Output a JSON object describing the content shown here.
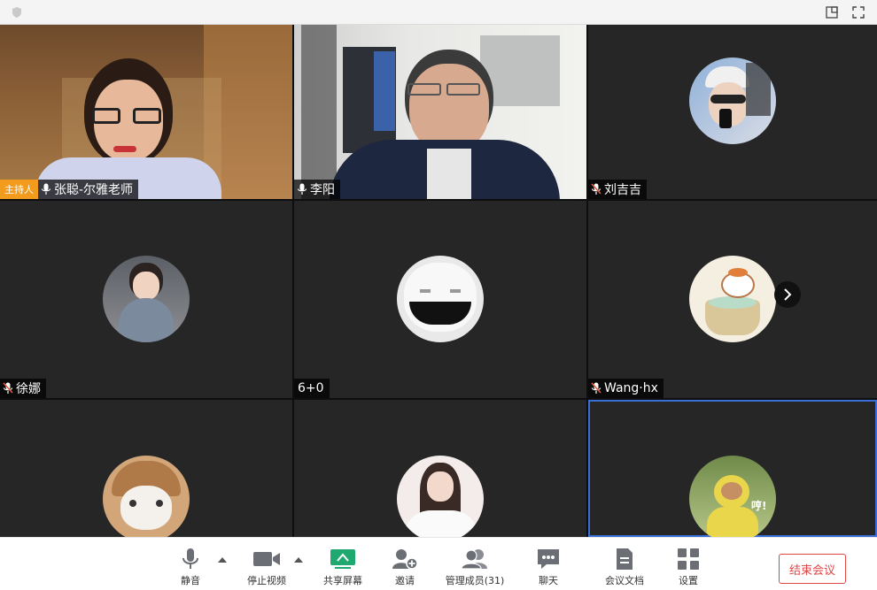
{
  "titlebar": {
    "shield_icon": "shield-icon",
    "layout_icon": "layout-icon",
    "fullscreen_icon": "fullscreen-icon"
  },
  "participants": [
    {
      "name": "张聪-尔雅老师",
      "host_badge": "主持人",
      "mic": "on",
      "video": "on"
    },
    {
      "name": "李阳",
      "mic": "on",
      "video": "on"
    },
    {
      "name": "刘吉吉",
      "mic": "muted",
      "video": "off"
    },
    {
      "name": "徐娜",
      "mic": "muted",
      "video": "off"
    },
    {
      "name": "6+0",
      "mic": "none",
      "video": "off"
    },
    {
      "name": "Wang·hx",
      "mic": "muted",
      "video": "off"
    },
    {
      "name": "",
      "mic": "none",
      "video": "off"
    },
    {
      "name": "",
      "mic": "none",
      "video": "off"
    },
    {
      "name": "",
      "mic": "none",
      "video": "off",
      "active_speaker": true
    }
  ],
  "next_page_icon": "chevron-right-icon",
  "avatar_caption": "哼!",
  "toolbar": {
    "mute": "静音",
    "stop_video": "停止视频",
    "share_screen": "共享屏幕",
    "invite": "邀请",
    "manage_members": "管理成员(31)",
    "chat": "聊天",
    "meeting_docs": "会议文档",
    "settings": "设置",
    "end_meeting": "结束会议"
  },
  "colors": {
    "host_badge": "#f29b1c",
    "share_accent": "#1fa971",
    "end_button": "#e04545",
    "active_border": "#3a6fd8",
    "muted_mic": "#e05a3a",
    "live_mic": "#ffffff"
  }
}
